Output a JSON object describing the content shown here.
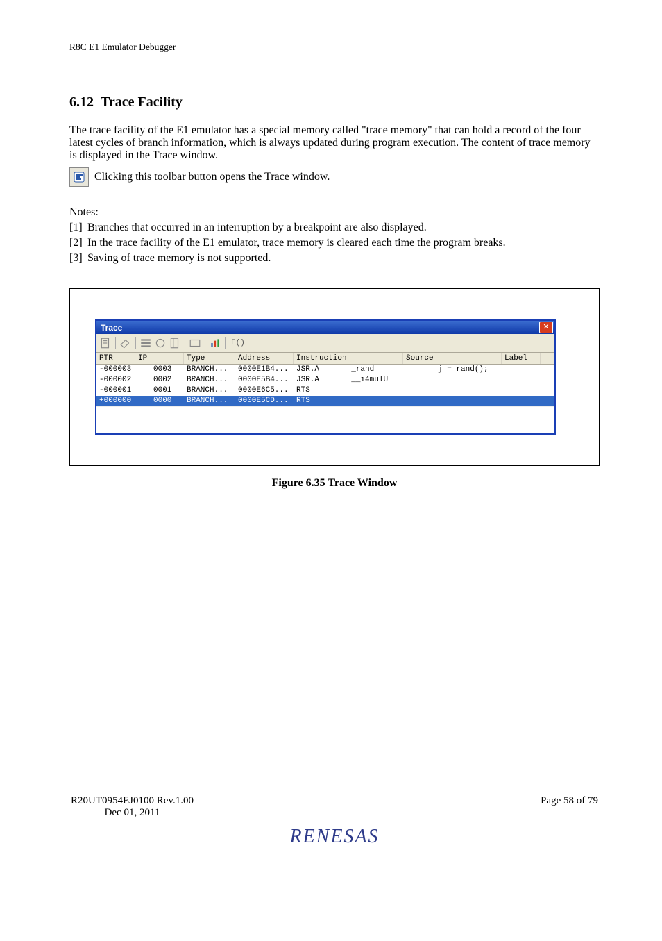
{
  "doc_header": "R8C E1 Emulator Debugger",
  "section_number": "6.12",
  "section_title": "Trace Facility",
  "paragraphs": {
    "intro_1": "The trace facility of the E1 emulator has a special memory called \"trace memory\" that can hold a record of the four latest cycles of branch information, which is always updated during program execution. The content of trace memory is displayed in the Trace window.",
    "intro_2": "Clicking this toolbar button opens the Trace window.",
    "notes_label": "Notes:",
    "note_1_num": "[1]",
    "note_1": "Branches that occurred in an interruption by a breakpoint are also displayed.",
    "note_2_num": "[2]",
    "note_2": "In the trace facility of the E1 emulator, trace memory is cleared each time the program breaks.",
    "note_3_num": "[3]",
    "note_3": "Saving of trace memory is not supported."
  },
  "trace_window": {
    "title": "Trace",
    "toolbar_func_label": "F()",
    "columns": [
      "PTR",
      "IP",
      "Type",
      "Address",
      "Instruction",
      "Source",
      "Label"
    ],
    "rows": [
      {
        "ptr": "-000003",
        "ip": "0003",
        "type": "BRANCH...",
        "addr": "0000E1B4...",
        "instr1": "JSR.A",
        "instr2": "_rand",
        "source": "j = rand();",
        "label": ""
      },
      {
        "ptr": "-000002",
        "ip": "0002",
        "type": "BRANCH...",
        "addr": "0000E5B4...",
        "instr1": "JSR.A",
        "instr2": "__i4mulU",
        "source": "",
        "label": ""
      },
      {
        "ptr": "-000001",
        "ip": "0001",
        "type": "BRANCH...",
        "addr": "0000E6C5...",
        "instr1": "RTS",
        "instr2": "",
        "source": "",
        "label": ""
      },
      {
        "ptr": "+000000",
        "ip": "0000",
        "type": "BRANCH...",
        "addr": "0000E5CD...",
        "instr1": "RTS",
        "instr2": "",
        "source": "",
        "label": ""
      }
    ]
  },
  "figure_caption": "Figure 6.35   Trace Window",
  "footer": {
    "doc_code": "R20UT0954EJ0100  Rev.1.00",
    "date": "Dec 01, 2011",
    "page_no": "Page 58 of 79",
    "brand": "RENESAS"
  }
}
